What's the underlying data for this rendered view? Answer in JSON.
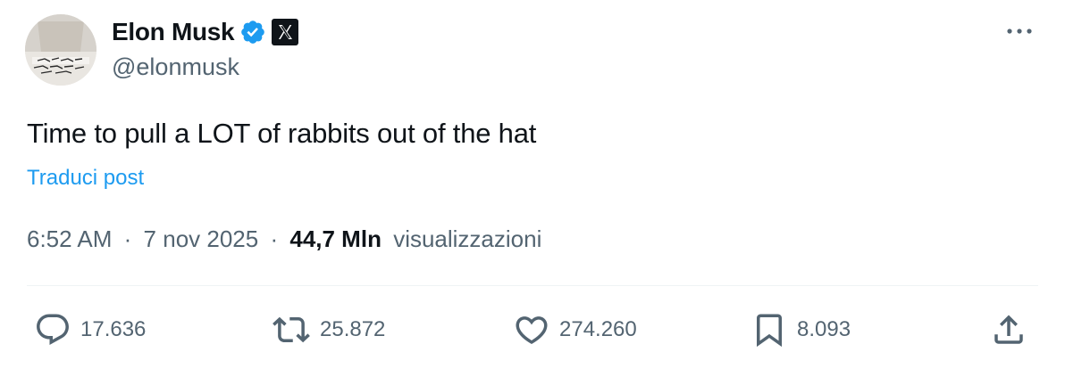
{
  "author": {
    "display_name": "Elon Musk",
    "handle": "@elonmusk",
    "verified_icon": "verified-badge-icon",
    "affiliation_icon": "x-logo-icon"
  },
  "tweet": {
    "text": "Time to pull a LOT of rabbits out of the hat",
    "translate_label": "Traduci post",
    "time": "6:52 AM",
    "separator": "·",
    "date": "7 nov 2025",
    "views_count": "44,7 Mln",
    "views_label": "visualizzazioni"
  },
  "actions": {
    "replies": "17.636",
    "reposts": "25.872",
    "likes": "274.260",
    "bookmarks": "8.093"
  },
  "colors": {
    "accent": "#1d9bf0",
    "text_primary": "#0f1419",
    "text_secondary": "#536471",
    "divider": "#eff3f4"
  }
}
